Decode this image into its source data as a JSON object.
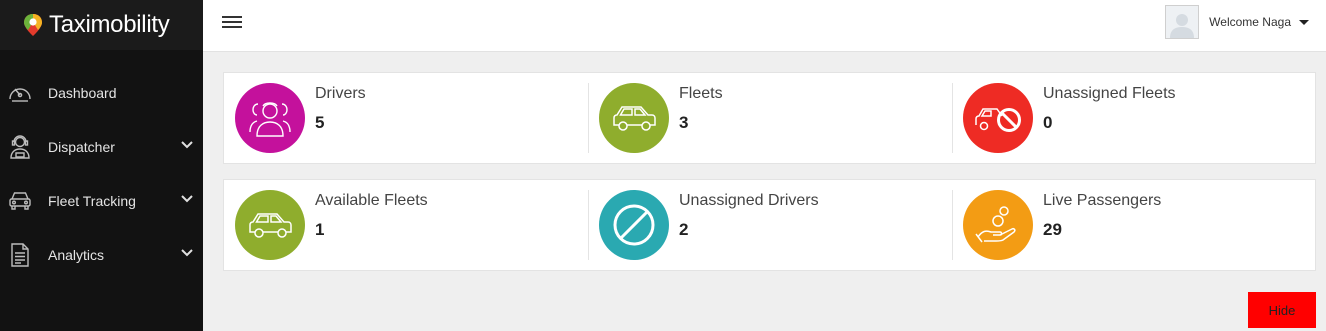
{
  "app": {
    "name": "Taximobility"
  },
  "sidebar": {
    "items": [
      {
        "label": "Dashboard",
        "icon": "speedometer-icon",
        "has_submenu": false
      },
      {
        "label": "Dispatcher",
        "icon": "dispatcher-headset-icon",
        "has_submenu": true
      },
      {
        "label": "Fleet Tracking",
        "icon": "car-front-icon",
        "has_submenu": true
      },
      {
        "label": "Analytics",
        "icon": "document-icon",
        "has_submenu": true
      }
    ]
  },
  "header": {
    "welcome_text": "Welcome Naga"
  },
  "stats": {
    "row1": [
      {
        "label": "Drivers",
        "value": "5",
        "color": "#c4119c",
        "icon": "drivers-group-icon"
      },
      {
        "label": "Fleets",
        "value": "3",
        "color": "#8fad2d",
        "icon": "car-icon"
      },
      {
        "label": "Unassigned Fleets",
        "value": "0",
        "color": "#ee2b24",
        "icon": "car-blocked-icon"
      }
    ],
    "row2": [
      {
        "label": "Available Fleets",
        "value": "1",
        "color": "#8fad2d",
        "icon": "car-icon"
      },
      {
        "label": "Unassigned Drivers",
        "value": "2",
        "color": "#2aa9b1",
        "icon": "prohibited-icon"
      },
      {
        "label": "Live Passengers",
        "value": "29",
        "color": "#f39c14",
        "icon": "hand-coins-icon"
      }
    ]
  },
  "actions": {
    "hide_label": "Hide",
    "hide_color": "#ff0000"
  }
}
